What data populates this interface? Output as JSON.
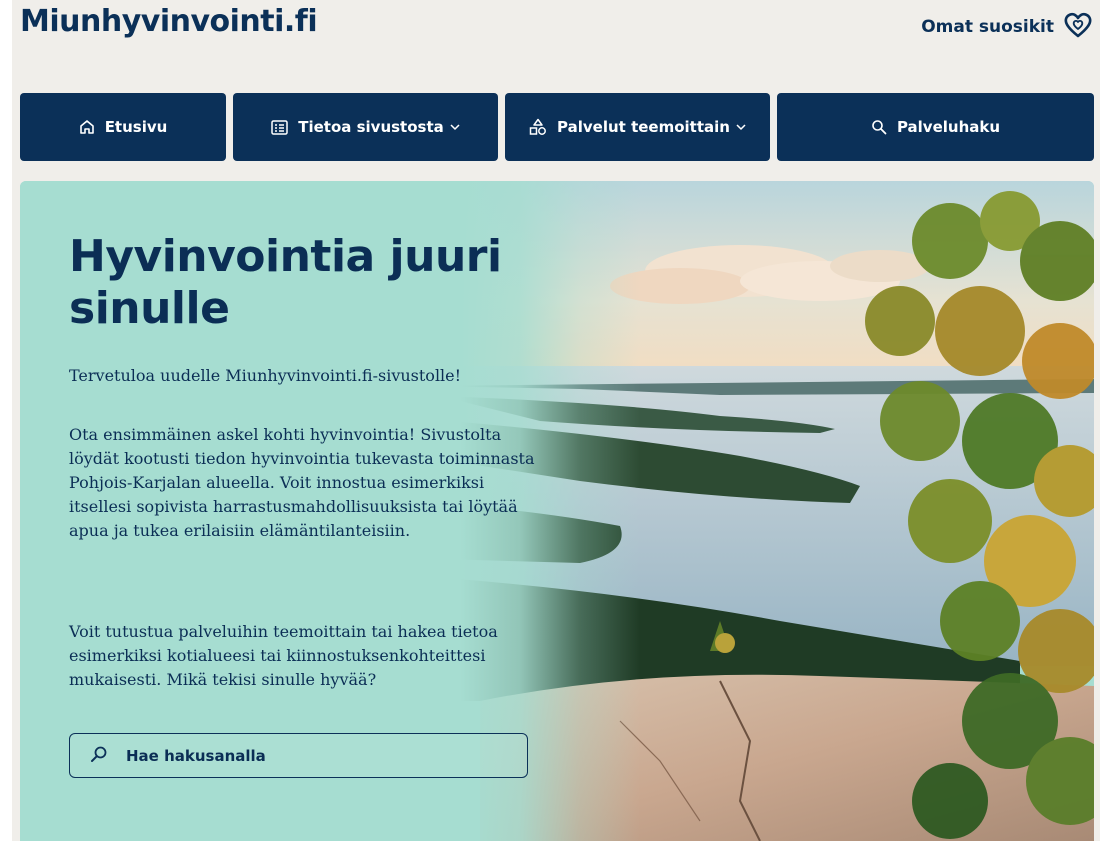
{
  "header": {
    "logo": "Miunhyvinvointi.fi",
    "favorites_label": "Omat suosikit"
  },
  "nav": {
    "home": "Etusivu",
    "about": "Tietoa sivustosta",
    "services": "Palvelut teemoittain",
    "search": "Palveluhaku"
  },
  "hero": {
    "title": "Hyvinvointia juuri sinulle",
    "intro": "Tervetuloa uudelle Miunhyvinvointi.fi-sivustolle!",
    "paragraph1": "Ota ensimmäinen askel kohti hyvinvointia! Sivustolta löydät kootusti tiedon hyvinvointia tukevasta toiminnasta Pohjois-Karjalan alueella. Voit innostua esimerkiksi itsellesi sopivista harrastusmahdollisuuksista tai löytää apua ja tukea erilaisiin elämäntilanteisiin.",
    "paragraph2": "Voit tutustua palveluihin teemoittain tai hakea tietoa esimerkiksi kotialueesi tai kiinnostuksenkohteittesi mukaisesti. Mikä tekisi sinulle hyvää?",
    "search_placeholder": "Hae hakusanalla"
  },
  "colors": {
    "brand_navy": "#0b3058",
    "hero_mint": "#a6ddd1",
    "page_bg": "#f0eeea"
  },
  "icons": {
    "favorites": "heart-icon",
    "home": "home-icon",
    "about": "list-icon",
    "services": "shapes-icon",
    "search": "search-icon",
    "dropdown": "chevron-down-icon"
  }
}
